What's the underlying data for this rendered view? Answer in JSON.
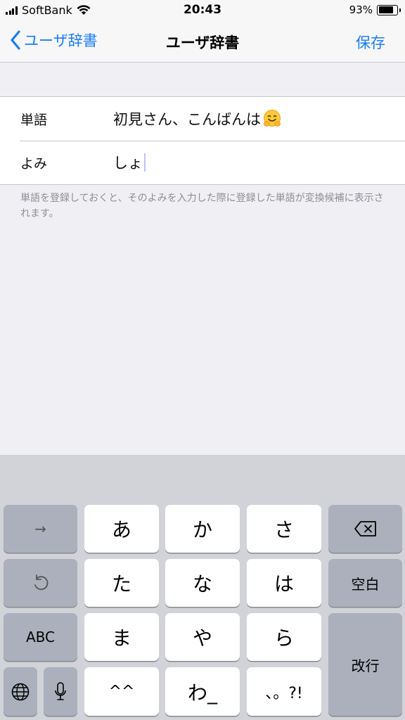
{
  "status_bar": {
    "carrier": "SoftBank",
    "time": "20:43",
    "battery_percent": "93%",
    "battery_level": 0.93
  },
  "nav": {
    "back_label": "ユーザ辞書",
    "title": "ユーザ辞書",
    "save_label": "保存"
  },
  "form": {
    "word_label": "単語",
    "word_value": "初見さん、こんばんは",
    "word_emoji": "hugging-face-emoji",
    "reading_label": "よみ",
    "reading_value": "しょ"
  },
  "hint": "単語を登録しておくと、そのよみを入力した際に登録した単語が変換候補に表示されます。",
  "keyboard": {
    "next_key": "→",
    "undo_icon": "undo-icon",
    "abc_key": "ABC",
    "globe_icon": "globe-icon",
    "mic_icon": "microphone-icon",
    "kana_keys": [
      "あ",
      "か",
      "さ",
      "た",
      "な",
      "は",
      "ま",
      "や",
      "ら",
      "^^",
      "わ_",
      "、。?!"
    ],
    "delete_icon": "delete-icon",
    "space_key": "空白",
    "return_key": "改行"
  },
  "colors": {
    "accent": "#1a7cf5",
    "keyboard_bg": "#d1d3d9",
    "function_key": "#abb0bc"
  }
}
